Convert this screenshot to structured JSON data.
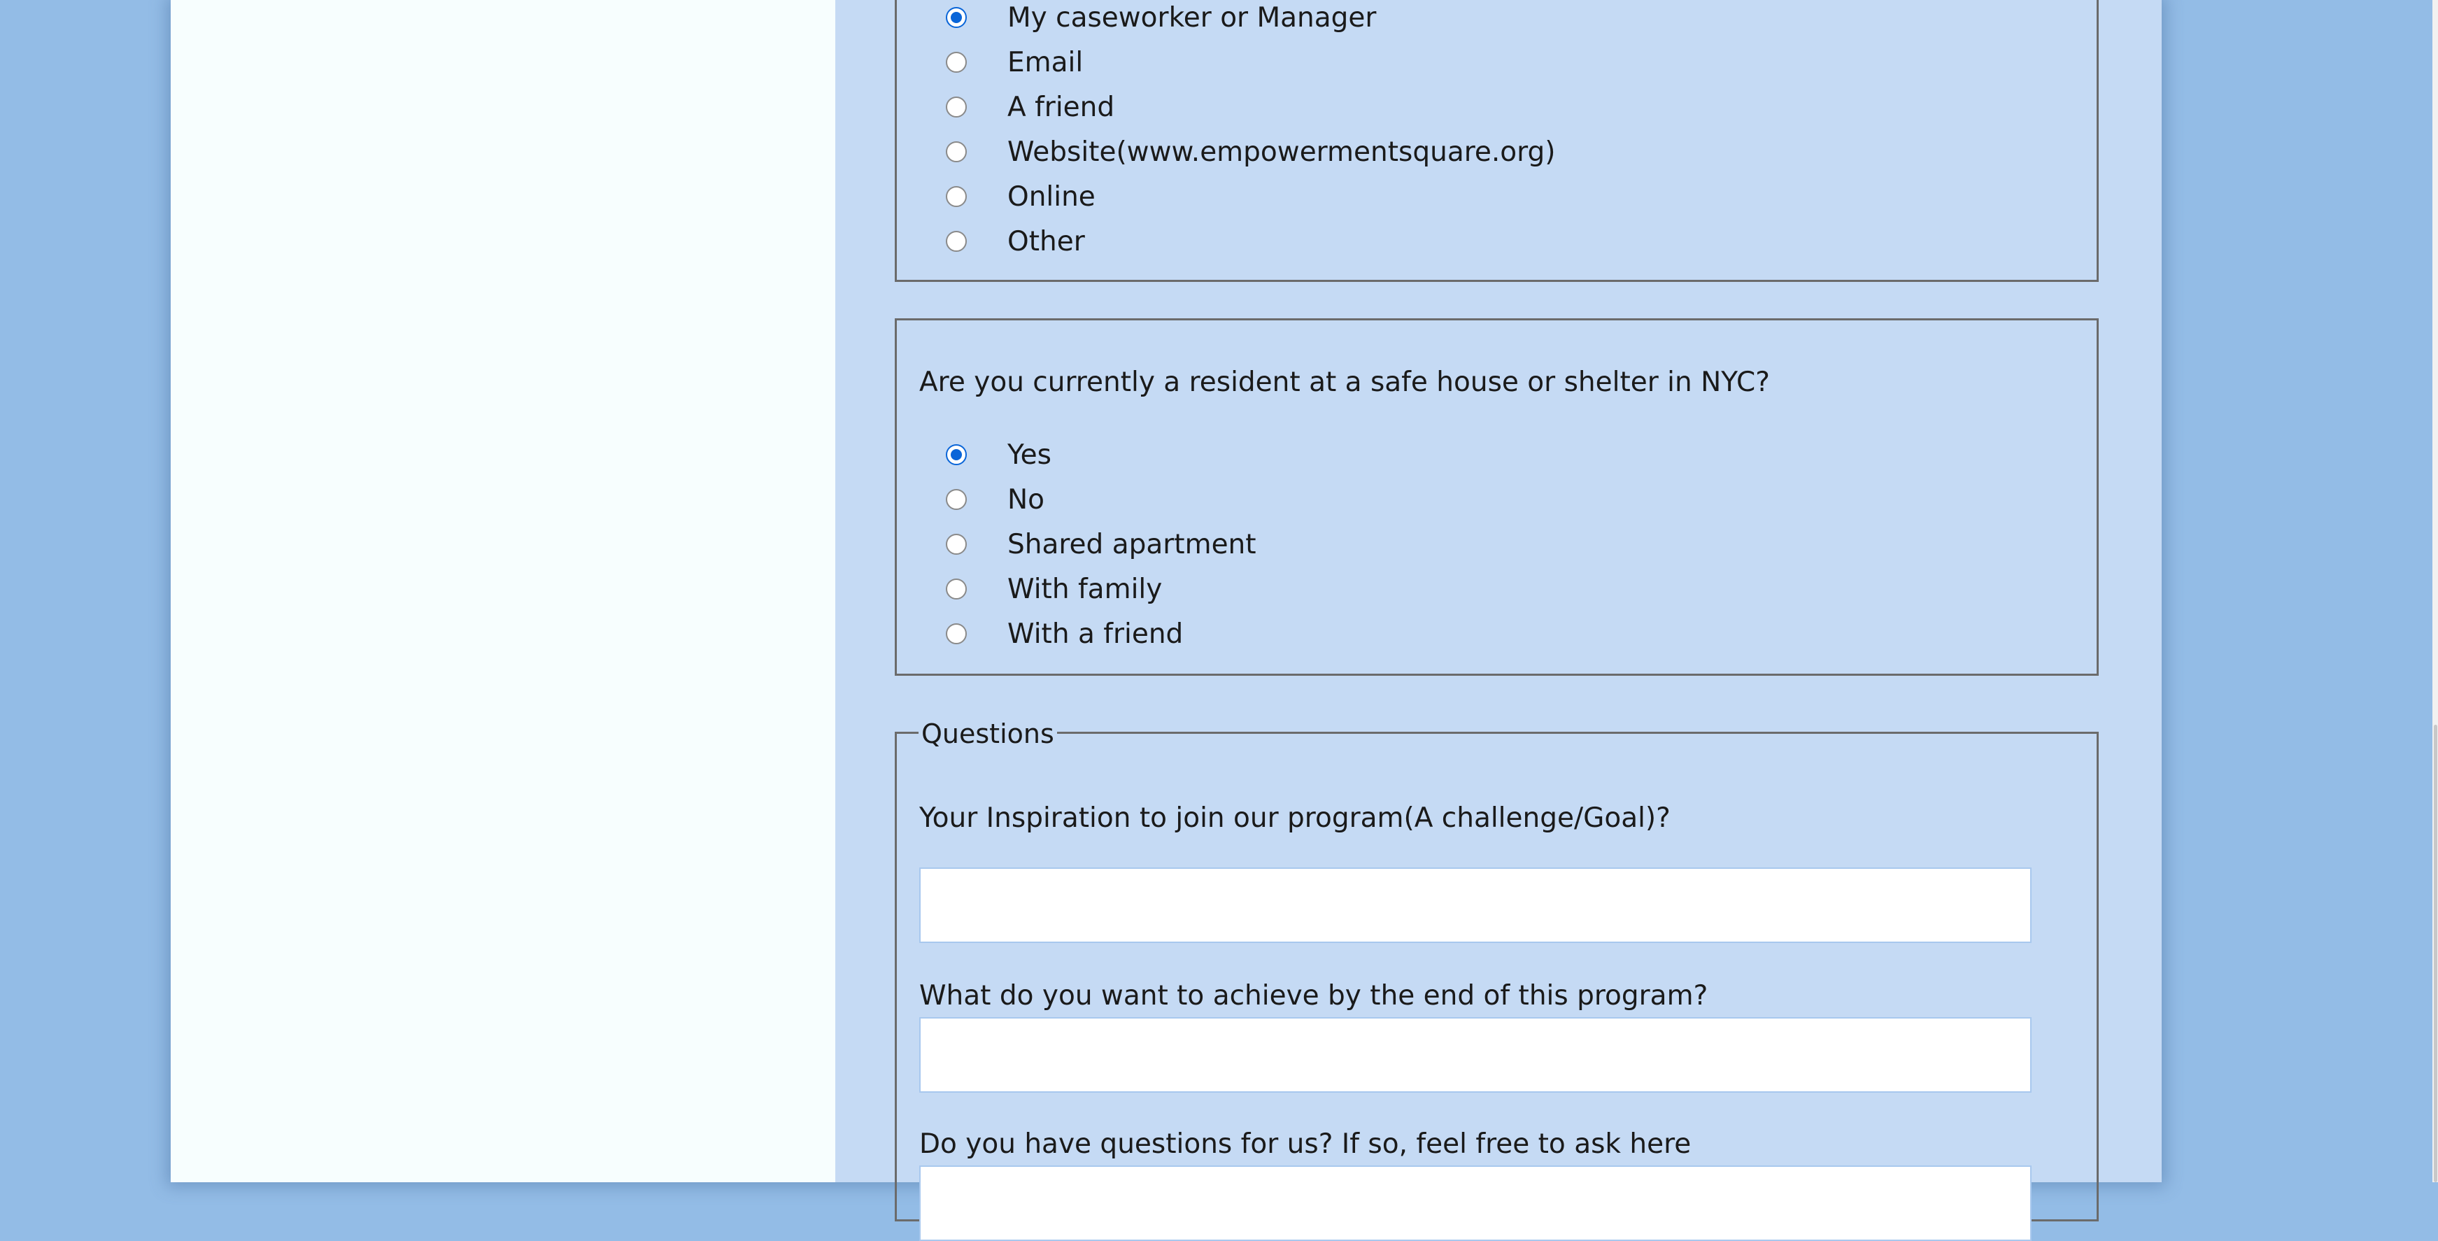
{
  "referral": {
    "options": [
      {
        "label": "My caseworker or Manager",
        "checked": true
      },
      {
        "label": "Email",
        "checked": false
      },
      {
        "label": "A friend",
        "checked": false
      },
      {
        "label": "Website(www.empowermentsquare.org)",
        "checked": false
      },
      {
        "label": "Online",
        "checked": false
      },
      {
        "label": "Other",
        "checked": false
      }
    ]
  },
  "residence": {
    "question": "Are you currently a resident at a safe house or shelter in NYC?",
    "options": [
      {
        "label": "Yes",
        "checked": true
      },
      {
        "label": "No",
        "checked": false
      },
      {
        "label": "Shared apartment",
        "checked": false
      },
      {
        "label": "With family",
        "checked": false
      },
      {
        "label": "With a friend",
        "checked": false
      }
    ]
  },
  "questions": {
    "legend": "Questions",
    "inspiration": {
      "label": "Your Inspiration to join our program(A challenge/Goal)?",
      "value": ""
    },
    "achieve": {
      "label": "What do you want to achieve by the end of this program?",
      "value": ""
    },
    "ask": {
      "label": "Do you have questions for us? If so, feel free to ask here",
      "value": ""
    }
  },
  "colors": {
    "outer_background": "#93bce6",
    "left_panel": "#f7fefe",
    "form_panel": "#c5daf4",
    "radio_checked": "#0a65d8",
    "fieldset_border": "#6b6b6b",
    "input_border": "#a8c8ee"
  }
}
